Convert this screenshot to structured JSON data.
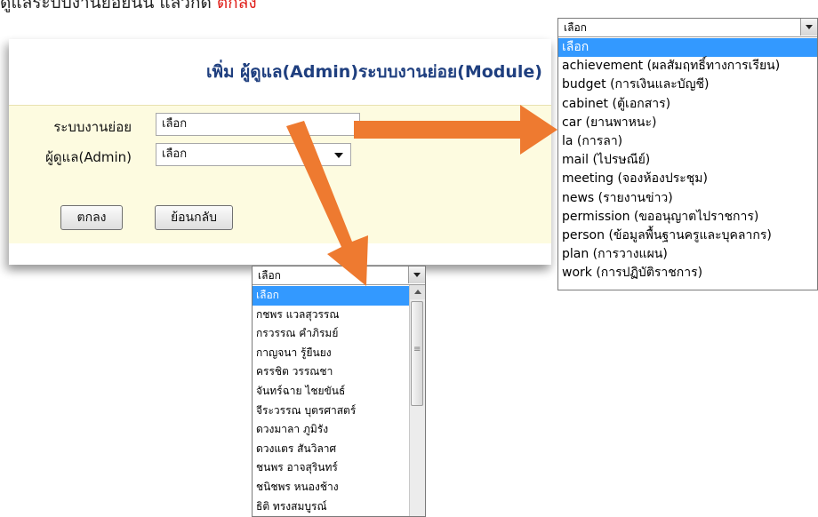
{
  "instruction": {
    "text": "ดูแลระบบงานย่อยนั้น แล้วกด ",
    "accent_text": "ตกลง",
    "accent_color": "#e0201b"
  },
  "form": {
    "title": "เพิ่ม ผู้ดูแล(Admin)ระบบงานย่อย(Module)",
    "title_color": "#1f3f7f",
    "panel_color": "#fdfbe0",
    "module_label": "ระบบงานย่อย",
    "module_value": "เลือก",
    "admin_label": "ผู้ดูแล(Admin)",
    "admin_value": "เลือก",
    "ok_button": "ตกลง",
    "back_button": "ย้อนกลับ"
  },
  "module_dropdown": {
    "current": "เลือก",
    "options": [
      "เลือก",
      "achievement (ผลสัมฤทธิ์ทางการเรียน)",
      "budget (การเงินและบัญชี)",
      "cabinet (ตู้เอกสาร)",
      "car (ยานพาหนะ)",
      "la (การลา)",
      "mail (ไปรษณีย์)",
      "meeting (จองห้องประชุม)",
      "news (รายงานข่าว)",
      "permission (ขออนุญาตไปราชการ)",
      "person (ข้อมูลพื้นฐานครูและบุคลากร)",
      "plan (การวางแผน)",
      "work (การปฏิบัติราชการ)"
    ]
  },
  "admin_dropdown": {
    "current": "เลือก",
    "options": [
      "เลือก",
      "กชพร แวลสุวรรณ",
      "กรวรรณ คำภิรมย์",
      "กาญจนา รู้ยืนยง",
      "ครรชิต วรรณชา",
      "จันทร์ฉาย ไชยขันธ์",
      "จีระวรรณ บุตรศาสตร์",
      "ดวงมาลา ภูมิรัง",
      "ดวงแตร สันวิลาศ",
      "ชนพร อาจสุรินทร์",
      "ชนิชพร หนองช้าง",
      "ธิติ ทรงสมบูรณ์"
    ]
  },
  "colors": {
    "arrow": "#ee7a30",
    "highlight": "#3399ff"
  },
  "icons": [
    "dropdown-caret-icon",
    "scroll-up-icon",
    "scroll-thumb-grip-icon",
    "pointer-arrow-icon"
  ]
}
